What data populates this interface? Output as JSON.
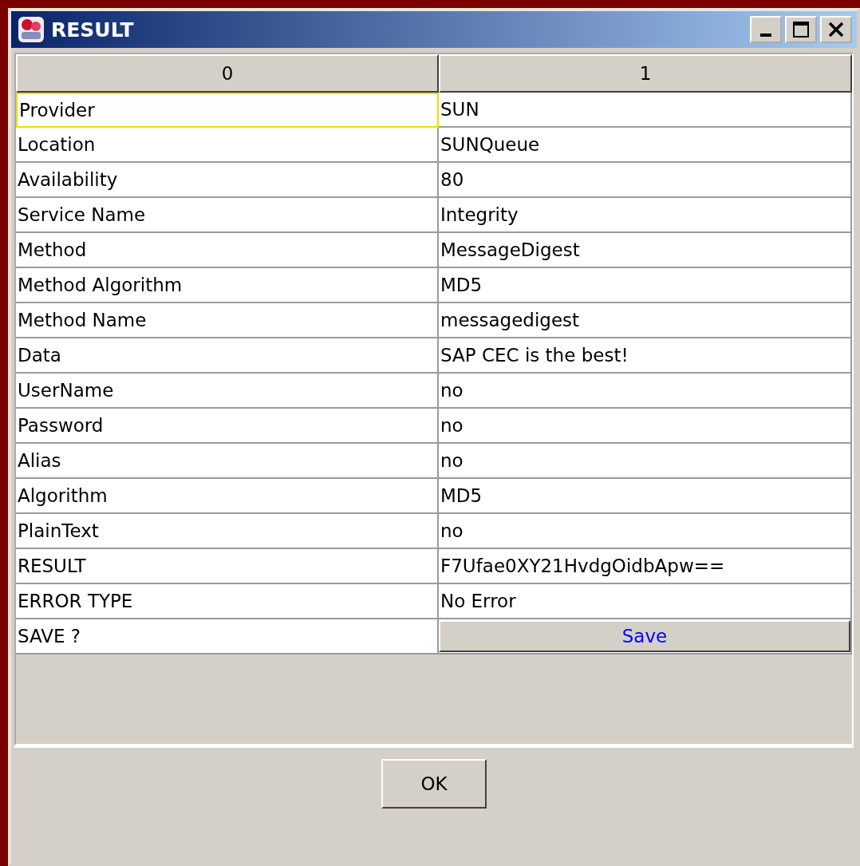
{
  "window": {
    "title": "RESULT"
  },
  "table": {
    "columns": [
      "0",
      "1"
    ],
    "rows": [
      {
        "label": "Provider",
        "value": "SUN",
        "kind": "text",
        "focused": true
      },
      {
        "label": "Location",
        "value": "SUNQueue",
        "kind": "text",
        "focused": false
      },
      {
        "label": "Availability",
        "value": "80",
        "kind": "text",
        "focused": false
      },
      {
        "label": "Service Name",
        "value": "Integrity",
        "kind": "text",
        "focused": false
      },
      {
        "label": "Method",
        "value": "MessageDigest",
        "kind": "text",
        "focused": false
      },
      {
        "label": "Method Algorithm",
        "value": "MD5",
        "kind": "text",
        "focused": false
      },
      {
        "label": "Method Name",
        "value": "messagedigest",
        "kind": "text",
        "focused": false
      },
      {
        "label": "Data",
        "value": "SAP CEC is the best!",
        "kind": "text",
        "focused": false
      },
      {
        "label": "UserName",
        "value": "no",
        "kind": "text",
        "focused": false
      },
      {
        "label": "Password",
        "value": "no",
        "kind": "text",
        "focused": false
      },
      {
        "label": "Alias",
        "value": "no",
        "kind": "text",
        "focused": false
      },
      {
        "label": "Algorithm",
        "value": "MD5",
        "kind": "text",
        "focused": false
      },
      {
        "label": "PlainText",
        "value": "no",
        "kind": "text",
        "focused": false
      },
      {
        "label": "RESULT",
        "value": "F7Ufae0XY21HvdgOidbApw==",
        "kind": "text",
        "focused": false
      },
      {
        "label": "ERROR TYPE",
        "value": "No Error",
        "kind": "text",
        "focused": false
      },
      {
        "label": "SAVE ?",
        "value": "Save",
        "kind": "button",
        "focused": false
      }
    ]
  },
  "buttons": [
    "OK"
  ]
}
